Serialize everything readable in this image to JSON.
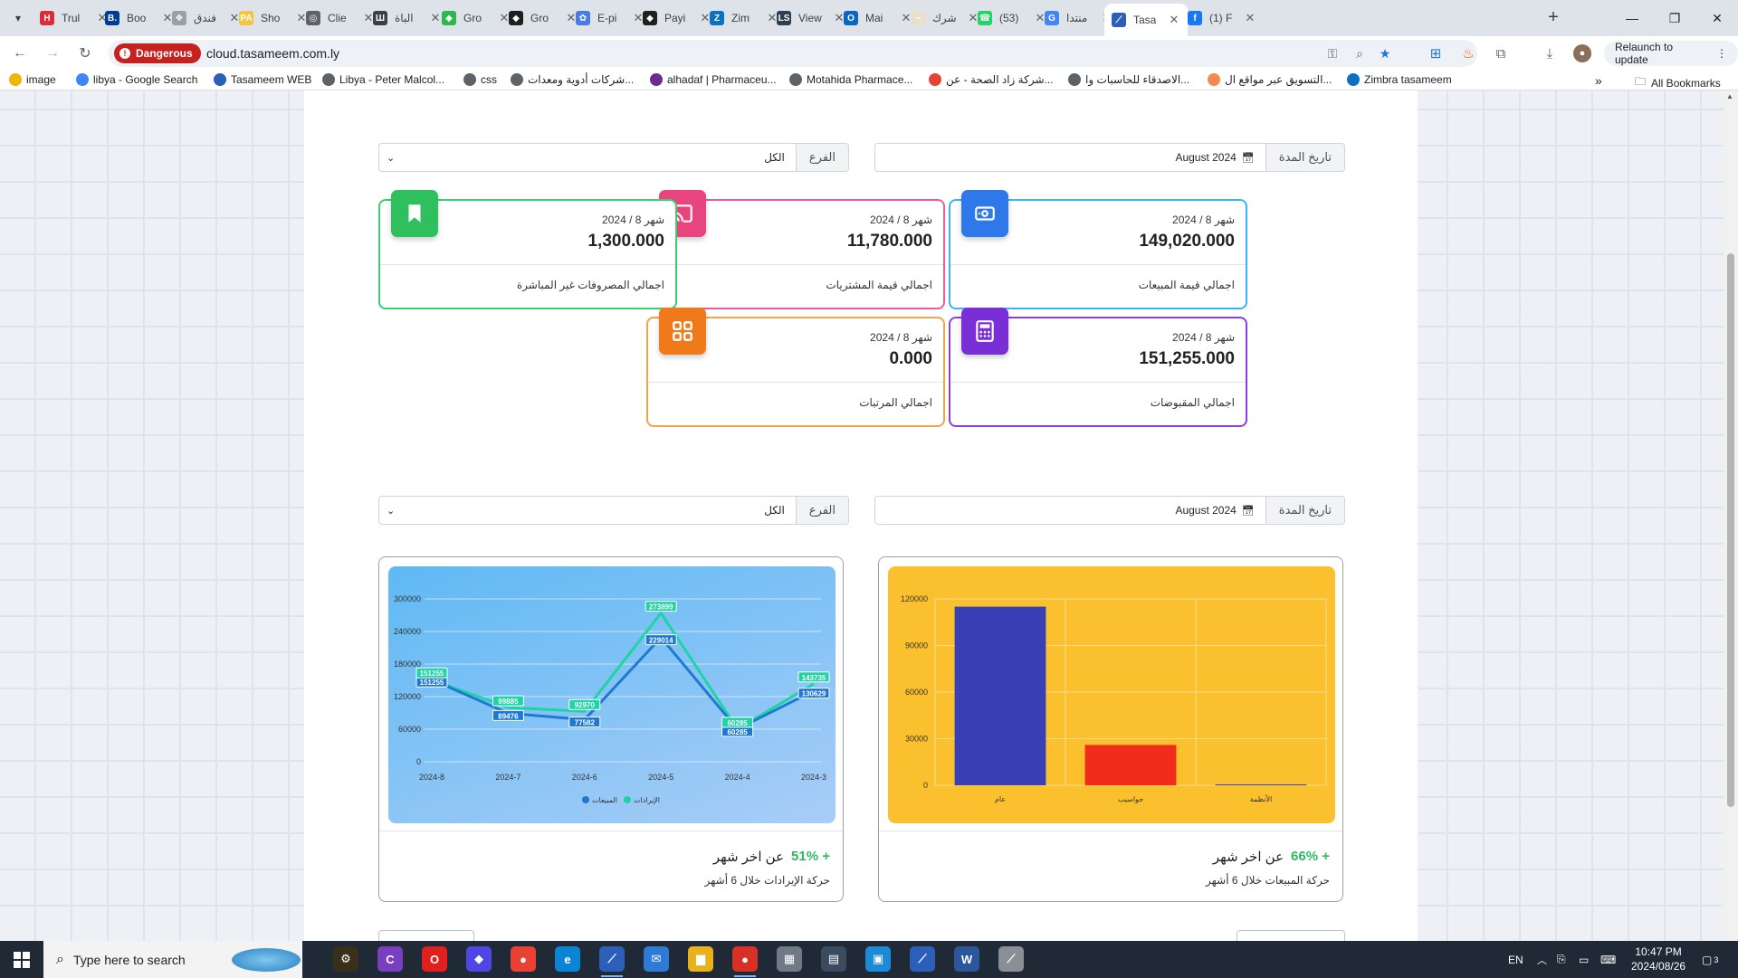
{
  "browser": {
    "tabs": [
      {
        "title": "Trul",
        "color": "#d92d3a",
        "glyph": "H"
      },
      {
        "title": "Boo",
        "color": "#003b95",
        "glyph": "B."
      },
      {
        "title": "فندق",
        "color": "#9aa0a6",
        "glyph": "❖"
      },
      {
        "title": "Sho",
        "color": "#f4c542",
        "glyph": "PA"
      },
      {
        "title": "Clie",
        "color": "#5f6368",
        "glyph": "◎"
      },
      {
        "title": "الباة",
        "color": "#3c4043",
        "glyph": "Ш"
      },
      {
        "title": "Gro",
        "color": "#2db84b",
        "glyph": "◆"
      },
      {
        "title": "Gro",
        "color": "#1f1f1f",
        "glyph": "◆"
      },
      {
        "title": "E-pi",
        "color": "#4a7be0",
        "glyph": "✿"
      },
      {
        "title": "Payi",
        "color": "#1f1f1f",
        "glyph": "◆"
      },
      {
        "title": "Zim",
        "color": "#0b72c2",
        "glyph": "Z"
      },
      {
        "title": "View",
        "color": "#2c3e50",
        "glyph": "LS"
      },
      {
        "title": "Mai",
        "color": "#0a66c2",
        "glyph": "O"
      },
      {
        "title": "شرك",
        "color": "#e8e0cc",
        "glyph": "~"
      },
      {
        "title": "(53)",
        "color": "#25d366",
        "glyph": "☎"
      },
      {
        "title": "منتدا",
        "color": "#4285f4",
        "glyph": "G"
      },
      {
        "title": "Tasa",
        "color": "#2b5fb8",
        "glyph": "⟋",
        "active": true
      },
      {
        "title": "(1) F",
        "color": "#1877f2",
        "glyph": "f"
      }
    ],
    "security_chip": "Dangerous",
    "url": "cloud.tasameem.com.ly",
    "relaunch_label": "Relaunch to update",
    "bookmarks": [
      {
        "label": "image",
        "color": "#f4b400"
      },
      {
        "label": "libya - Google Search",
        "color": "#4285f4"
      },
      {
        "label": "Tasameem WEB",
        "color": "#2b5fb8"
      },
      {
        "label": "Libya - Peter Malcol...",
        "color": "#5f6368"
      },
      {
        "label": "css",
        "color": "#5f6368"
      },
      {
        "label": "شركات أدوية ومعدات...",
        "color": "#5f6368"
      },
      {
        "label": "alhadaf | Pharmaceu...",
        "color": "#6a2c91"
      },
      {
        "label": "Motahida Pharmace...",
        "color": "#5f6368"
      },
      {
        "label": "شركة زاد الصحة - عن...",
        "color": "#e94235"
      },
      {
        "label": "الاصدقاء للحاسبات وا...",
        "color": "#5f6368"
      },
      {
        "label": "التسويق عبر مواقع ال...",
        "color": "#f28b50"
      },
      {
        "label": "Zimbra tasameem",
        "color": "#0b72c2"
      }
    ],
    "all_bookmarks": "All Bookmarks"
  },
  "filters": {
    "date_label": "تاريخ المدة",
    "date_value": "August 2024",
    "branch_label": "الفرع",
    "branch_value": "الكل"
  },
  "cards": [
    {
      "key": "sales",
      "period": "شهر 8 / 2024",
      "amount": "149,020.000",
      "label": "اجمالي قيمة المبيعات",
      "color": "#38b6f4",
      "badge": "#2f78e9",
      "icon": "money-icon"
    },
    {
      "key": "purchases",
      "period": "شهر 8 / 2024",
      "amount": "11,780.000",
      "label": "اجمالي قيمة المشتريات",
      "color": "#ee5b9a",
      "badge": "#e8457f",
      "icon": "cast-icon"
    },
    {
      "key": "expenses",
      "period": "شهر 8 / 2024",
      "amount": "1,300.000",
      "label": "اجمالي المصروفات غير المباشرة",
      "color": "#3ccf72",
      "badge": "#2fbf5e",
      "icon": "bookmark-icon"
    },
    {
      "key": "receipts",
      "period": "شهر 8 / 2024",
      "amount": "151,255.000",
      "label": "اجمالي المقبوضات",
      "color": "#8a3fe0",
      "badge": "#7a2fd6",
      "icon": "calculator-icon"
    },
    {
      "key": "salaries",
      "period": "شهر 8 / 2024",
      "amount": "0.000",
      "label": "اجمالي المرتبات",
      "color": "#f6a24a",
      "badge": "#f07a1a",
      "icon": "grid-icon"
    }
  ],
  "sales_chart": {
    "pct": "+ 66%",
    "pct_text": "عن اخر شهر",
    "subtitle": "حركة المبيعات خلال 6 أشهر"
  },
  "revenue_chart": {
    "pct": "+ 51%",
    "pct_text": "عن اخر شهر",
    "subtitle": "حركة الإيرادات خلال 6 أشهر"
  },
  "chart_data": [
    {
      "type": "bar",
      "categories": [
        "عام",
        "حواسيب",
        "الأنظمة"
      ],
      "values": [
        115000,
        26000,
        300
      ],
      "colors": [
        "#3940b5",
        "#f22c1a",
        "#3940b5"
      ],
      "yticks": [
        0,
        30000,
        60000,
        90000,
        120000
      ],
      "ylim": [
        0,
        120000
      ],
      "grid": true
    },
    {
      "type": "line",
      "categories": [
        "2024-8",
        "2024-7",
        "2024-6",
        "2024-5",
        "2024-4",
        "2024-3"
      ],
      "series": [
        {
          "name": "المبيعات",
          "values": [
            151255,
            89476,
            77582,
            229014,
            60285,
            130629
          ],
          "color": "#1f78d1"
        },
        {
          "name": "الإيرادات",
          "values": [
            151255,
            99885,
            92970,
            273899,
            60285,
            143735
          ],
          "color": "#1ed3a4"
        }
      ],
      "yticks": [
        0,
        60000,
        120000,
        180000,
        240000,
        300000
      ],
      "ylim": [
        0,
        300000
      ],
      "legend": "bottom",
      "grid": true
    }
  ],
  "taskbar": {
    "search_placeholder": "Type here to search",
    "lang": "EN",
    "time": "10:47 PM",
    "date": "2024/08/26",
    "notif_count": "3"
  }
}
